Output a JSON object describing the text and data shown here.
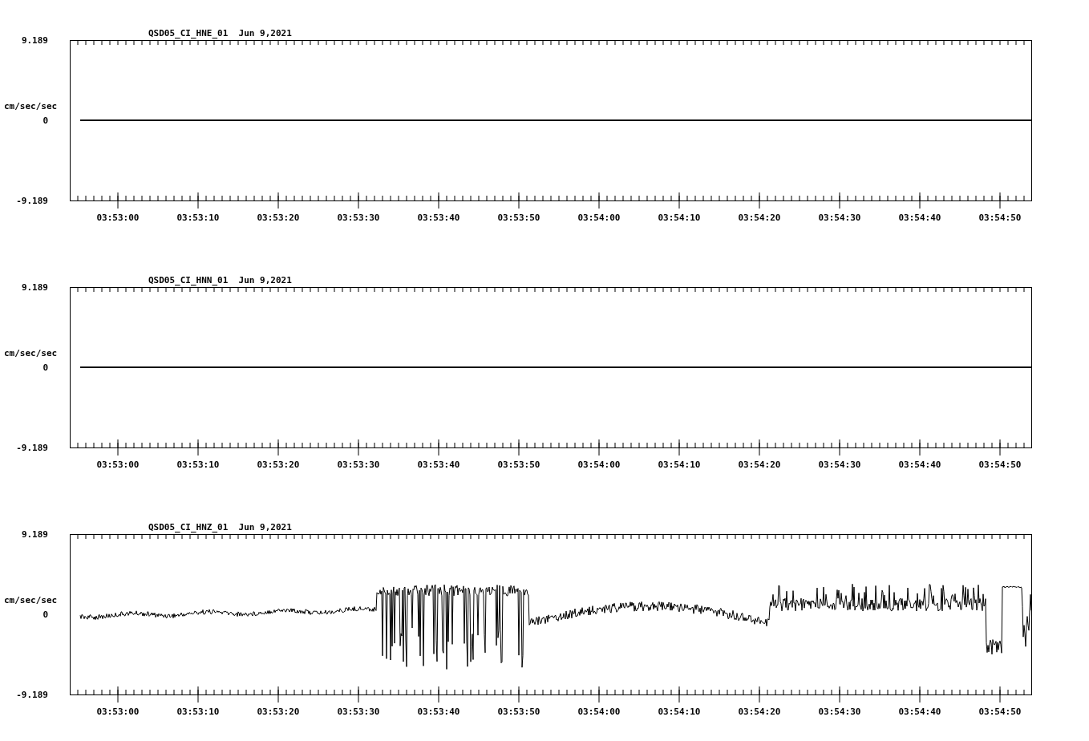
{
  "panels": [
    {
      "title": "QSD05_CI_HNE_01  Jun 9,2021",
      "unit": "cm/sec/sec",
      "yticks": [
        "9.189",
        "0",
        "-9.189"
      ],
      "kind": "flat",
      "xticks": [
        "03:53:00",
        "03:53:10",
        "03:53:20",
        "03:53:30",
        "03:53:40",
        "03:53:50",
        "03:54:00",
        "03:54:10",
        "03:54:20",
        "03:54:30",
        "03:54:40",
        "03:54:50"
      ]
    },
    {
      "title": "QSD05_CI_HNN_01  Jun 9,2021",
      "unit": "cm/sec/sec",
      "yticks": [
        "9.189",
        "0",
        "-9.189"
      ],
      "kind": "flat",
      "xticks": [
        "03:53:00",
        "03:53:10",
        "03:53:20",
        "03:53:30",
        "03:53:40",
        "03:53:50",
        "03:54:00",
        "03:54:10",
        "03:54:20",
        "03:54:30",
        "03:54:40",
        "03:54:50"
      ]
    },
    {
      "title": "QSD05_CI_HNZ_01  Jun 9,2021",
      "unit": "cm/sec/sec",
      "yticks": [
        "9.189",
        "0",
        "-9.189"
      ],
      "kind": "active",
      "xticks": [
        "03:53:00",
        "03:53:10",
        "03:53:20",
        "03:53:30",
        "03:53:40",
        "03:53:50",
        "03:54:00",
        "03:54:10",
        "03:54:20",
        "03:54:30",
        "03:54:40",
        "03:54:50"
      ]
    }
  ]
}
